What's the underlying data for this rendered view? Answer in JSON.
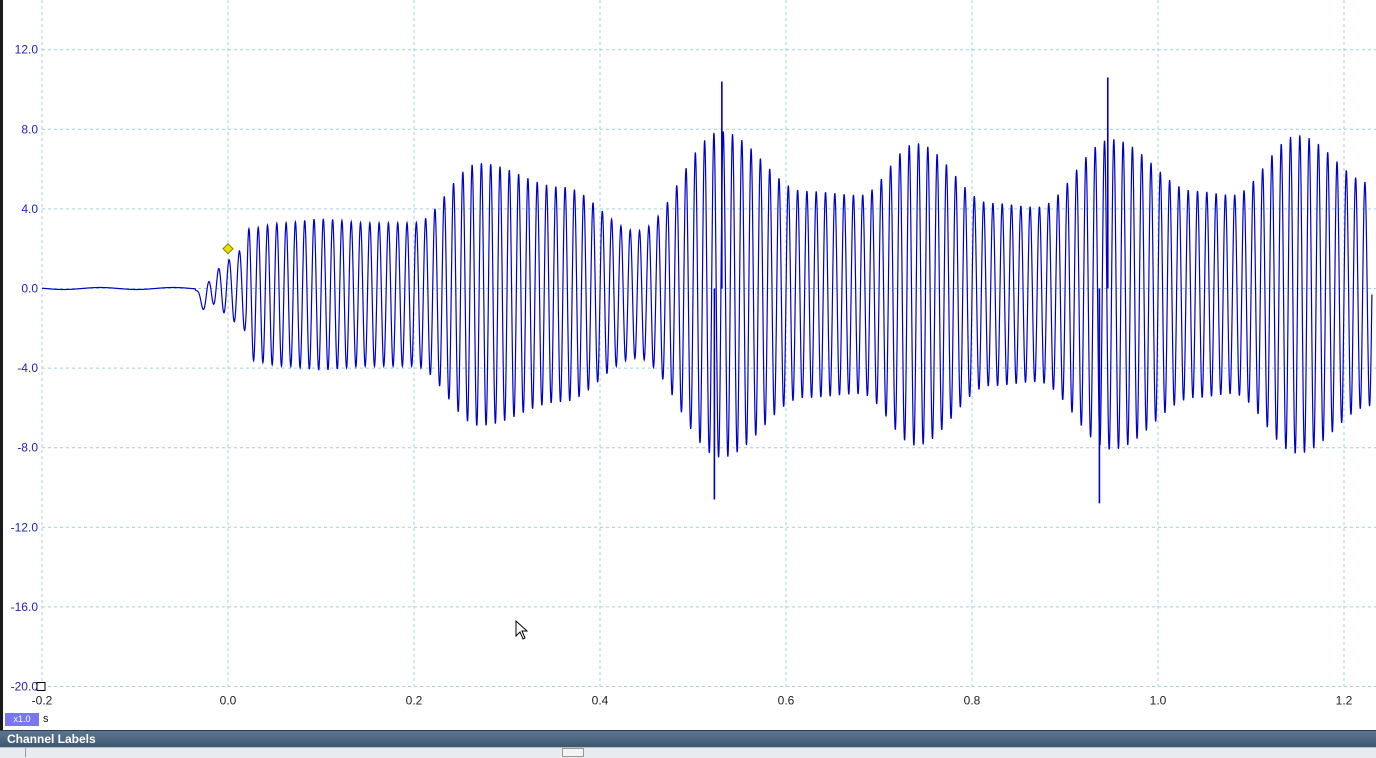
{
  "chart_data": {
    "type": "line",
    "x_unit": "s",
    "xlim": [
      -0.2,
      1.23
    ],
    "ylim": [
      -20.0,
      13.0
    ],
    "x_ticks": [
      "-0.2",
      "0.0",
      "0.2",
      "0.4",
      "0.6",
      "0.8",
      "1.0",
      "1.2"
    ],
    "y_ticks": [
      "12.0",
      "8.0",
      "4.0",
      "0.0",
      "-4.0",
      "-8.0",
      "-12.0",
      "-16.0",
      "-20.0"
    ],
    "grid": true,
    "series": [
      {
        "color": "#0000cc",
        "trigger_time": -0.035,
        "frequency_hz": 100,
        "envelope": [
          [
            0.02,
            3.3
          ],
          [
            0.06,
            3.6
          ],
          [
            0.1,
            3.8
          ],
          [
            0.15,
            3.6
          ],
          [
            0.2,
            3.6
          ],
          [
            0.27,
            6.6
          ],
          [
            0.36,
            5.4
          ],
          [
            0.44,
            3.2
          ],
          [
            0.53,
            8.2
          ],
          [
            0.62,
            5.2
          ],
          [
            0.68,
            5.0
          ],
          [
            0.74,
            7.6
          ],
          [
            0.82,
            4.6
          ],
          [
            0.87,
            4.4
          ],
          [
            0.95,
            7.8
          ],
          [
            1.04,
            5.2
          ],
          [
            1.08,
            5.0
          ],
          [
            1.15,
            8.0
          ],
          [
            1.23,
            5.6
          ]
        ],
        "spikes": [
          [
            0.523,
            -10.6
          ],
          [
            0.531,
            10.4
          ],
          [
            0.937,
            -10.8
          ],
          [
            0.946,
            10.6
          ]
        ]
      }
    ],
    "trigger_marker": {
      "x": 0.0,
      "y": 2.0,
      "color": "#e8e000"
    }
  },
  "scope": {
    "zoom_badge": "x1.0",
    "x_unit": "s"
  },
  "channel_panel": {
    "title": "Channel Labels"
  }
}
